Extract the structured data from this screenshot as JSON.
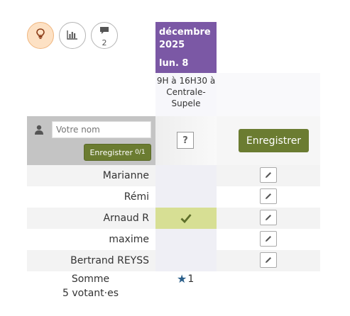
{
  "toolbar": {
    "buttons": [
      {
        "name": "lightbulb-icon",
        "count": ""
      },
      {
        "name": "bar-chart-icon",
        "count": ""
      },
      {
        "name": "comment-icon",
        "count": "2"
      }
    ]
  },
  "column": {
    "month": "décembre 2025",
    "day": "lun. 8",
    "description": "9H à 16H30 à Centrale-Supele"
  },
  "new_vote": {
    "name_placeholder": "Votre nom",
    "save_small_label": "Enregistrer",
    "save_small_count": "0/1",
    "unknown_mark": "?",
    "save_big_label": "Enregistrer"
  },
  "participants": [
    {
      "name": "Marianne",
      "vote": ""
    },
    {
      "name": "Rémi",
      "vote": ""
    },
    {
      "name": "Arnaud R",
      "vote": "yes"
    },
    {
      "name": "maxime",
      "vote": ""
    },
    {
      "name": "Bertrand REYSS",
      "vote": ""
    }
  ],
  "summary": {
    "label_line1": "Somme",
    "label_line2": "5 votant·es",
    "value": "1"
  },
  "colors": {
    "accent": "#7b58a5",
    "save_green": "#6b7c31",
    "yes_green": "#d7df94",
    "star_blue": "#2b5f8a"
  }
}
